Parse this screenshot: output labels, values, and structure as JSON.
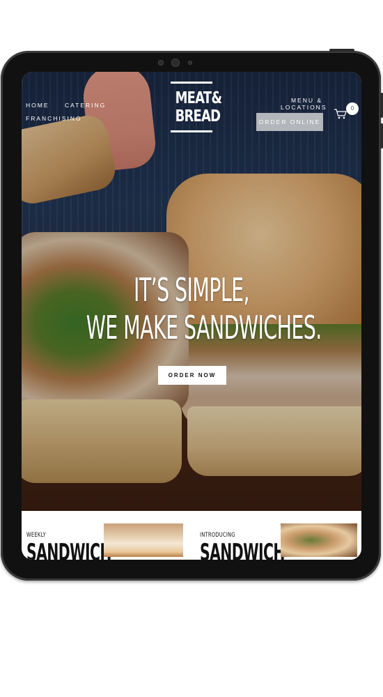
{
  "nav": {
    "home": "HOME",
    "catering": "CATERING",
    "franchising": "FRANCHISING",
    "menu_locations_line1": "MENU &",
    "menu_locations_line2": "LOCATIONS",
    "order_online": "ORDER ONLINE",
    "cart_count": "0",
    "cart_icon": "shopping-cart-icon"
  },
  "logo": {
    "line1": "MEAT&",
    "line2": "BREAD"
  },
  "hero": {
    "headline_line1": "IT’S SIMPLE,",
    "headline_line2": "WE MAKE SANDWICHES.",
    "cta": "ORDER NOW"
  },
  "cards": [
    {
      "eyebrow": "WEEKLY",
      "title": "SANDWICH"
    },
    {
      "eyebrow": "INTRODUCING",
      "title": "SANDWICH"
    }
  ],
  "colors": {
    "order_online_bg": "#b3b6ba",
    "hero_bg": "#253a5c",
    "device_frame": "#111111"
  }
}
